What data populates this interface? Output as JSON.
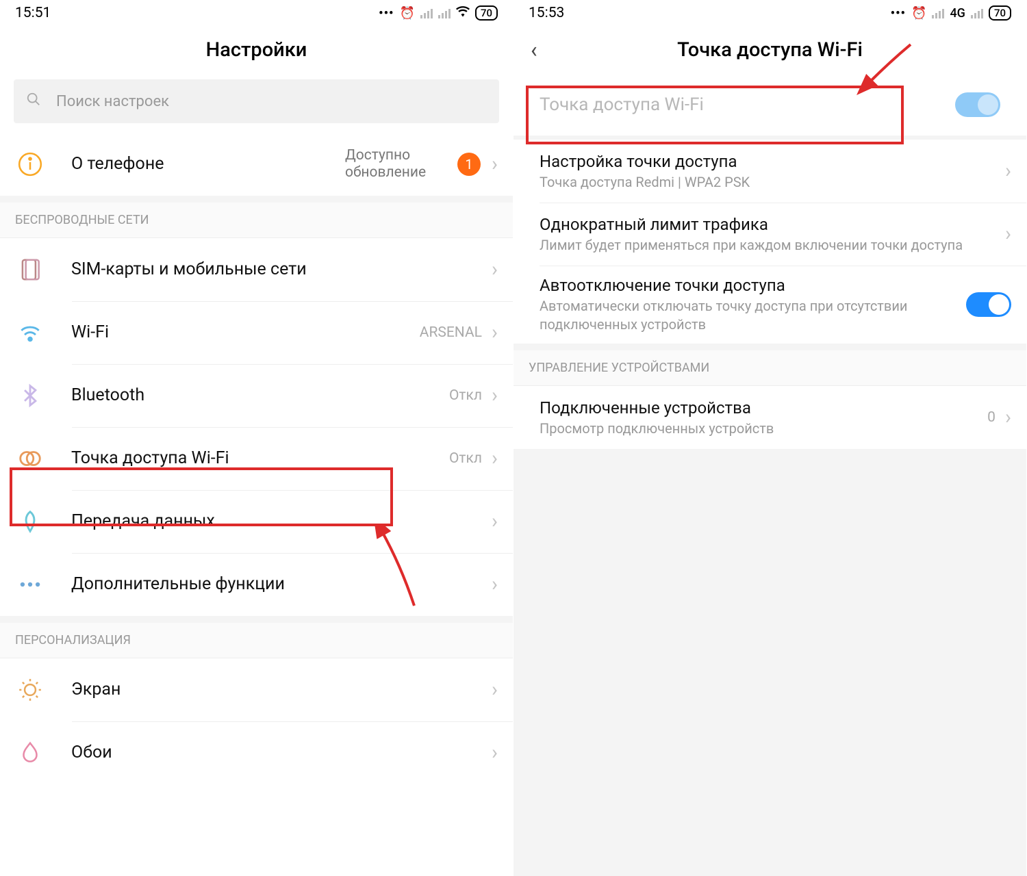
{
  "left": {
    "time": "15:51",
    "battery": "70",
    "title": "Настройки",
    "search_placeholder": "Поиск настроек",
    "about": {
      "label": "О телефоне",
      "note": "Доступно обновление",
      "badge": "1"
    },
    "group_wireless": "БЕСПРОВОДНЫЕ СЕТИ",
    "items_wireless": [
      {
        "label": "SIM-карты и мобильные сети",
        "value": ""
      },
      {
        "label": "Wi-Fi",
        "value": "ARSENAL"
      },
      {
        "label": "Bluetooth",
        "value": "Откл"
      },
      {
        "label": "Точка доступа Wi-Fi",
        "value": "Откл"
      },
      {
        "label": "Передача данных",
        "value": ""
      },
      {
        "label": "Дополнительные функции",
        "value": ""
      }
    ],
    "group_personal": "ПЕРСОНАЛИЗАЦИЯ",
    "items_personal": [
      {
        "label": "Экран"
      },
      {
        "label": "Обои"
      }
    ]
  },
  "right": {
    "time": "15:53",
    "battery": "70",
    "net_label": "4G",
    "title": "Точка доступа Wi-Fi",
    "hotspot_toggle_label": "Точка доступа Wi-Fi",
    "rows": [
      {
        "title": "Настройка точки доступа",
        "sub": "Точка доступа Redmi | WPA2 PSK"
      },
      {
        "title": "Однократный лимит трафика",
        "sub": "Лимит будет применяться при каждом включении точки доступа"
      },
      {
        "title": "Автоотключение точки доступа",
        "sub": "Автоматически отключать точку доступа при отсутствии подключенных устройств"
      }
    ],
    "group_devices": "УПРАВЛЕНИЕ УСТРОЙСТВАМИ",
    "devices_row": {
      "title": "Подключенные устройства",
      "sub": "Просмотр подключенных устройств",
      "count": "0"
    }
  }
}
